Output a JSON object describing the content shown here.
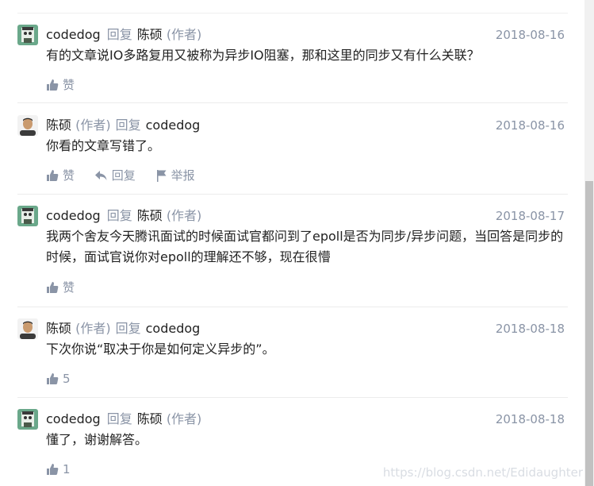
{
  "reply_word": "回复",
  "author_tag": "(作者)",
  "like_label": "赞",
  "reply_label": "回复",
  "report_label": "举报",
  "watermark": "https://blog.csdn.net/Edidaughter",
  "comments": [
    {
      "user": "codedog",
      "user_is_author": false,
      "target": "陈硕",
      "target_is_author": true,
      "date": "2018-08-16",
      "text": "有的文章说IO多路复用又被称为异步IO阻塞，那和这里的同步又有什么关联？",
      "likes": ""
    },
    {
      "user": "陈硕",
      "user_is_author": true,
      "target": "codedog",
      "target_is_author": false,
      "date": "2018-08-16",
      "text": "你看的文章写错了。",
      "likes": ""
    },
    {
      "user": "codedog",
      "user_is_author": false,
      "target": "陈硕",
      "target_is_author": true,
      "date": "2018-08-17",
      "text": "我两个舍友今天腾讯面试的时候面试官都问到了epoll是否为同步/异步问题，当回答是同步的时候，面试官说你对epoll的理解还不够，现在很懵",
      "likes": ""
    },
    {
      "user": "陈硕",
      "user_is_author": true,
      "target": "codedog",
      "target_is_author": false,
      "date": "2018-08-18",
      "text": "下次你说“取决于你是如何定义异步的”。",
      "likes": "5"
    },
    {
      "user": "codedog",
      "user_is_author": false,
      "target": "陈硕",
      "target_is_author": true,
      "date": "2018-08-18",
      "text": "懂了，谢谢解答。",
      "likes": "1"
    }
  ],
  "colors": {
    "muted": "#8a94a6",
    "text": "#222222",
    "divider": "#ececec"
  }
}
